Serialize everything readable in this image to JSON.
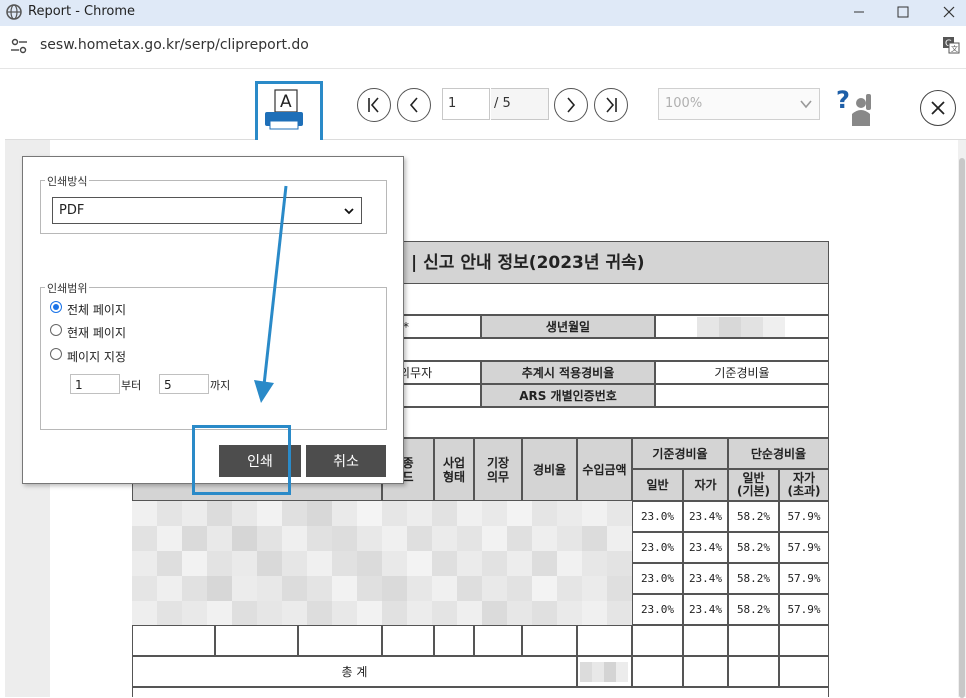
{
  "window": {
    "title": "Report - Chrome",
    "url": "sesw.hometax.go.kr/serp/clipreport.do"
  },
  "toolbar": {
    "print_icon_label": "A",
    "page_current": "1",
    "page_total": "/ 5",
    "zoom": "100%",
    "help_mark": "?"
  },
  "dialog": {
    "method_legend": "인쇄방식",
    "method_value": "PDF",
    "range_legend": "인쇄범위",
    "options": [
      "전체 페이지",
      "현재 페이지",
      "페이지 지정"
    ],
    "selected_option": 0,
    "from_value": "1",
    "from_label": "부터",
    "to_value": "5",
    "to_label": "까지",
    "print_label": "인쇄",
    "cancel_label": "취소"
  },
  "report": {
    "title": "| 신고 안내 정보(2023년 귀속)",
    "star": "*",
    "birth_label": "생년월일",
    "row2_left": "의무자",
    "rate_label": "추계시 적용경비율",
    "rate_value": "기준경비율",
    "ars_label": "ARS 개별인증번호",
    "headers": {
      "industry_code": "종\n드",
      "biz_type": "사업\n형태",
      "bookkeeping": "기장\n의무",
      "expense_rate": "경비율",
      "income": "수입금액",
      "standard_rate": "기준경비율",
      "simple_rate": "단순경비율",
      "general": "일반",
      "self": "자가",
      "general_basic": "일반\n(기본)",
      "self_excess": "자가\n(초과)"
    },
    "rows": [
      [
        "23.0%",
        "23.4%",
        "58.2%",
        "57.9%"
      ],
      [
        "23.0%",
        "23.4%",
        "58.2%",
        "57.9%"
      ],
      [
        "23.0%",
        "23.4%",
        "58.2%",
        "57.9%"
      ],
      [
        "23.0%",
        "23.4%",
        "58.2%",
        "57.9%"
      ]
    ],
    "total_label": "총  계"
  }
}
